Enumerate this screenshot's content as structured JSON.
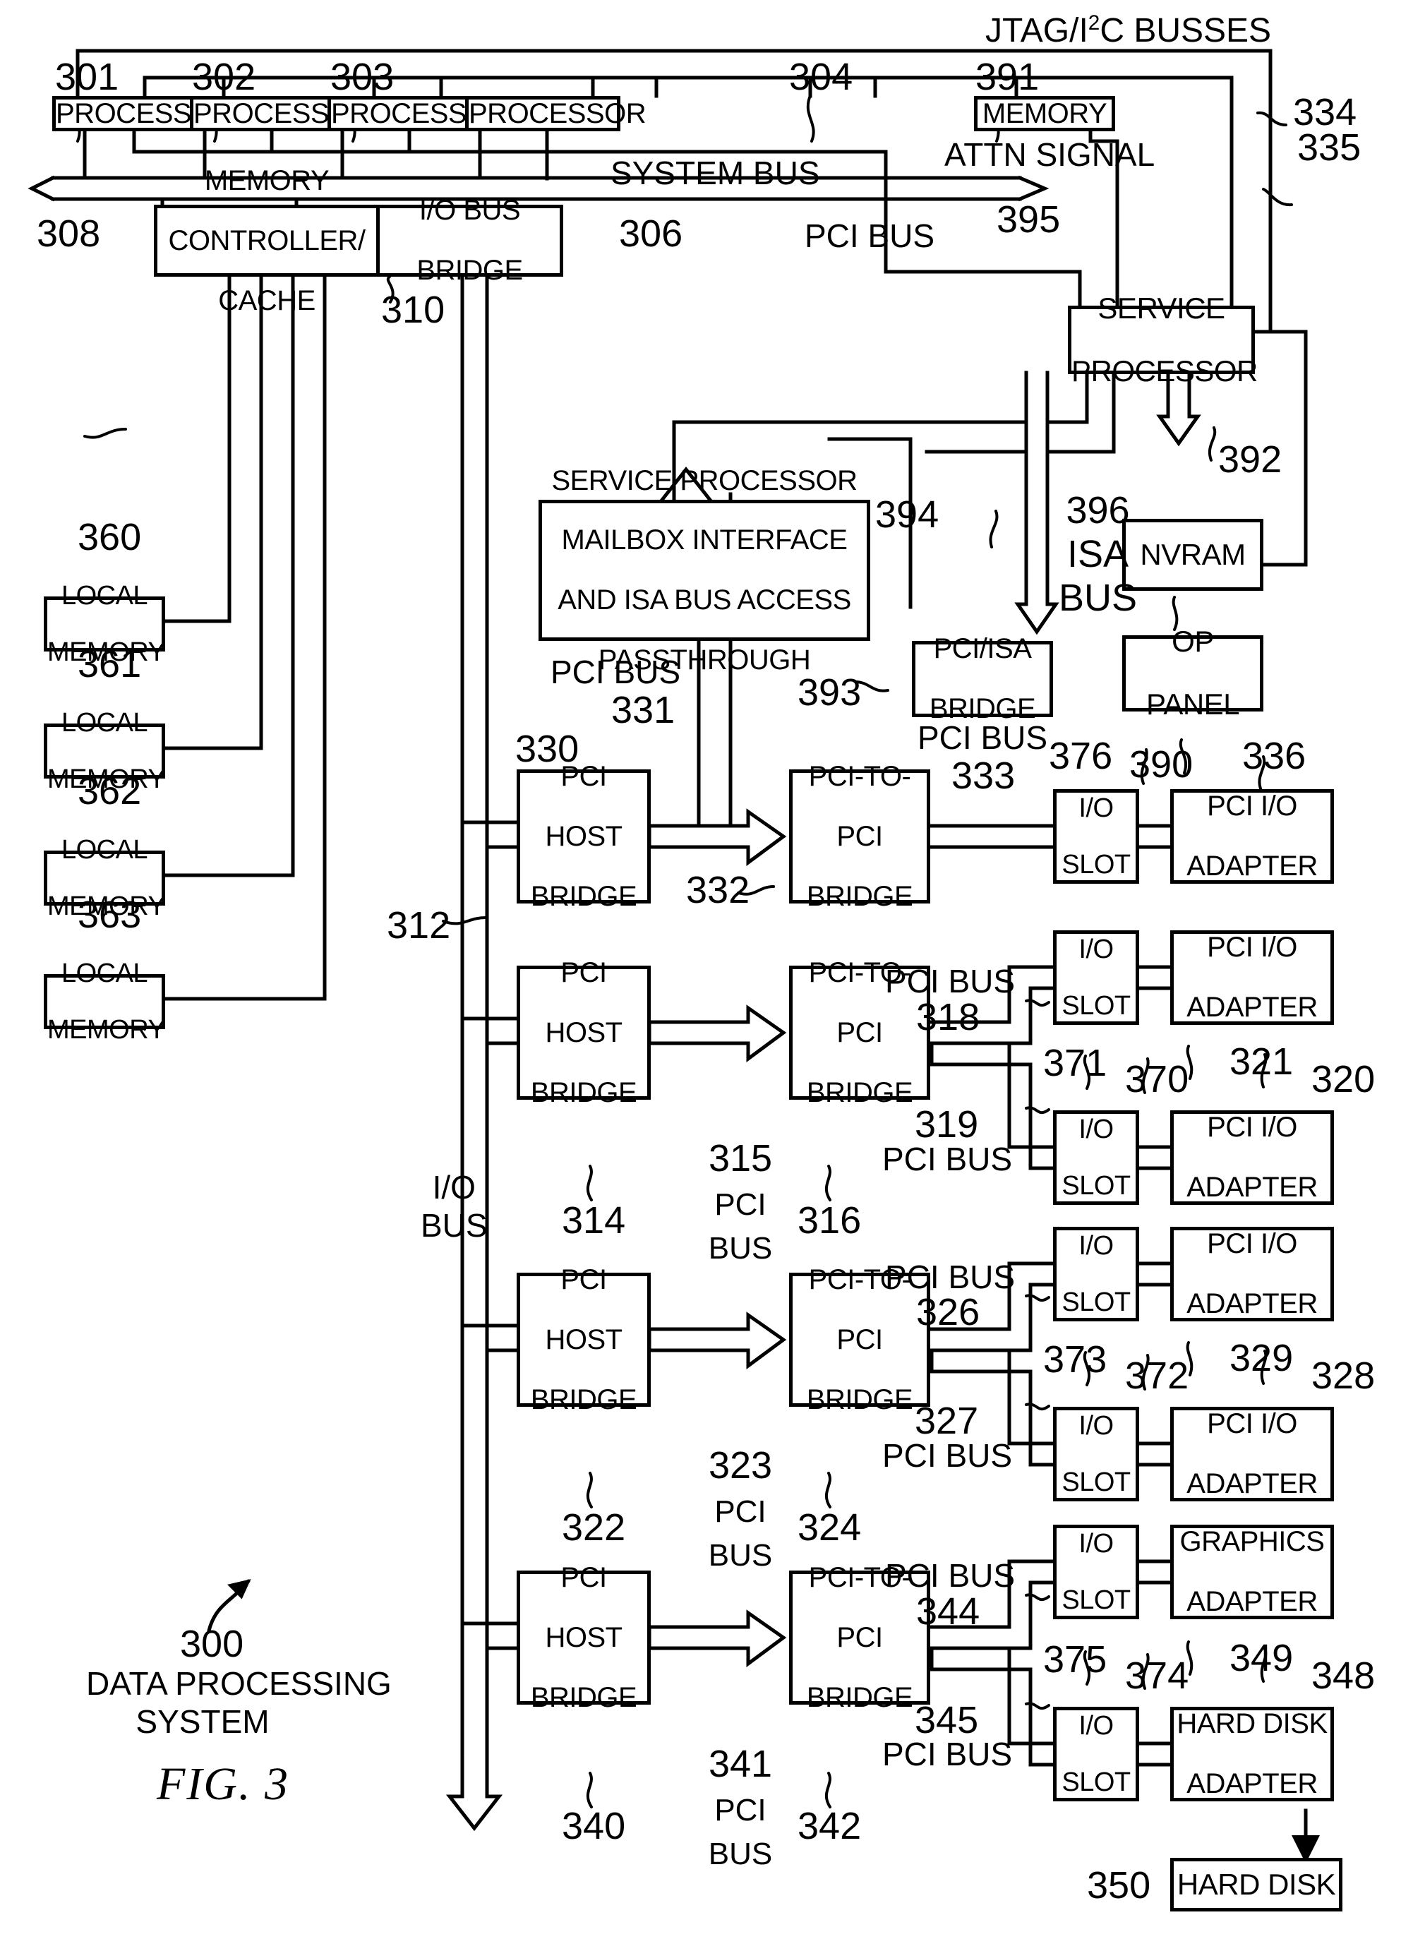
{
  "figure": {
    "caption": "FIG. 3",
    "system_label_number": "300",
    "system_label_line1": "DATA PROCESSING",
    "system_label_line2": "SYSTEM"
  },
  "top_bus": {
    "jtag_label_pre": "JTAG/I",
    "jtag_label_sup": "2",
    "jtag_label_post": "C BUSSES",
    "jtag_ref": "334",
    "service_proc_ref": "335",
    "attn_signal": "ATTN SIGNAL"
  },
  "processors": [
    {
      "label": "PROCESSOR",
      "ref": "301"
    },
    {
      "label": "PROCESSOR",
      "ref": "302"
    },
    {
      "label": "PROCESSOR",
      "ref": "303"
    },
    {
      "label": "PROCESSOR",
      "ref": "304"
    }
  ],
  "memory": {
    "label": "MEMORY",
    "ref": "391"
  },
  "system_bus": {
    "label": "SYSTEM BUS",
    "ref": "306"
  },
  "memory_controller": {
    "line1": "MEMORY",
    "line2": "CONTROLLER/",
    "line3": "CACHE",
    "ref": "308"
  },
  "io_bus_bridge": {
    "line1": "I/O BUS",
    "line2": "BRIDGE",
    "ref": "310"
  },
  "io_bus": {
    "line1": "I/O",
    "line2": "BUS",
    "ref": "312"
  },
  "local_memories": [
    {
      "line1": "LOCAL",
      "line2": "MEMORY",
      "ref": "360"
    },
    {
      "line1": "LOCAL",
      "line2": "MEMORY",
      "ref": "361"
    },
    {
      "line1": "LOCAL",
      "line2": "MEMORY",
      "ref": "362"
    },
    {
      "line1": "LOCAL",
      "line2": "MEMORY",
      "ref": "363"
    }
  ],
  "service_processor": {
    "line1": "SERVICE",
    "line2": "PROCESSOR"
  },
  "mailbox": {
    "line1": "SERVICE PROCESSOR",
    "line2": "MAILBOX INTERFACE",
    "line3": "AND ISA BUS ACCESS",
    "line4": "PASSTHROUGH",
    "ref": "394",
    "in_bus_label": "PCI BUS",
    "in_bus_ref": "331",
    "top_bus_label": "PCI BUS",
    "top_bus_ref": "395"
  },
  "pci_isa_bridge": {
    "line1": "PCI/ISA",
    "line2": "BRIDGE",
    "ref": "393"
  },
  "isa_bus": {
    "ref": "396",
    "line1": "ISA",
    "line2": "BUS"
  },
  "nvram": {
    "label": "NVRAM",
    "ref": "392"
  },
  "op_panel": {
    "line1": "OP",
    "line2": "PANEL",
    "ref": "390"
  },
  "pci_host_bridges": [
    {
      "line1": "PCI",
      "line2": "HOST",
      "line3": "BRIDGE",
      "ref": "330"
    },
    {
      "line1": "PCI",
      "line2": "HOST",
      "line3": "BRIDGE",
      "ref": "314"
    },
    {
      "line1": "PCI",
      "line2": "HOST",
      "line3": "BRIDGE",
      "ref": "322"
    },
    {
      "line1": "PCI",
      "line2": "HOST",
      "line3": "BRIDGE",
      "ref": "340"
    }
  ],
  "pci_to_pci_bridges": [
    {
      "line1": "PCI-TO-",
      "line2": "PCI",
      "line3": "BRIDGE",
      "ref": "332"
    },
    {
      "line1": "PCI-TO-",
      "line2": "PCI",
      "line3": "BRIDGE",
      "ref": "316"
    },
    {
      "line1": "PCI-TO-",
      "line2": "PCI",
      "line3": "BRIDGE",
      "ref": "324"
    },
    {
      "line1": "PCI-TO-",
      "line2": "PCI",
      "line3": "BRIDGE",
      "ref": "342"
    }
  ],
  "internal_pci_buses": [
    {
      "ref": "331",
      "line1": "PCI",
      "line2": "BUS"
    },
    {
      "ref": "315",
      "line1": "PCI",
      "line2": "BUS"
    },
    {
      "ref": "323",
      "line1": "PCI",
      "line2": "BUS"
    },
    {
      "ref": "341",
      "line1": "PCI",
      "line2": "BUS"
    }
  ],
  "output_pci_buses": [
    {
      "label": "PCI BUS",
      "ref": "333"
    },
    {
      "label": "PCI BUS",
      "ref": "318"
    },
    {
      "label": "PCI BUS",
      "ref": "319"
    },
    {
      "label": "PCI BUS",
      "ref": "326"
    },
    {
      "label": "PCI BUS",
      "ref": "327"
    },
    {
      "label": "PCI BUS",
      "ref": "344"
    },
    {
      "label": "PCI BUS",
      "ref": "345"
    }
  ],
  "io_slots": [
    {
      "line1": "I/O",
      "line2": "SLOT",
      "ref": "376"
    },
    {
      "line1": "I/O",
      "line2": "SLOT",
      "ref": "370",
      "ref2": "371"
    },
    {
      "line1": "I/O",
      "line2": "SLOT",
      "ref": "372",
      "ref2": "373"
    },
    {
      "line1": "I/O",
      "line2": "SLOT",
      "ref": "374",
      "ref2": "375"
    }
  ],
  "adapters": [
    {
      "line1": "PCI I/O",
      "line2": "ADAPTER",
      "ref": "336",
      "slot_ref": "390"
    },
    {
      "line1": "PCI I/O",
      "line2": "ADAPTER",
      "ref": "320",
      "slot_ref": "321"
    },
    {
      "line1": "PCI I/O",
      "line2": "ADAPTER",
      "ref": "328",
      "slot_ref": "329"
    },
    {
      "line1": "GRAPHICS",
      "line2": "ADAPTER",
      "ref": "348",
      "slot_ref": "349"
    },
    {
      "line1": "HARD DISK",
      "line2": "ADAPTER",
      "ref": "",
      "slot_ref": ""
    }
  ],
  "hard_disk": {
    "label": "HARD DISK",
    "ref": "350"
  },
  "colors": {
    "ink": "#000000",
    "paper": "#ffffff"
  }
}
